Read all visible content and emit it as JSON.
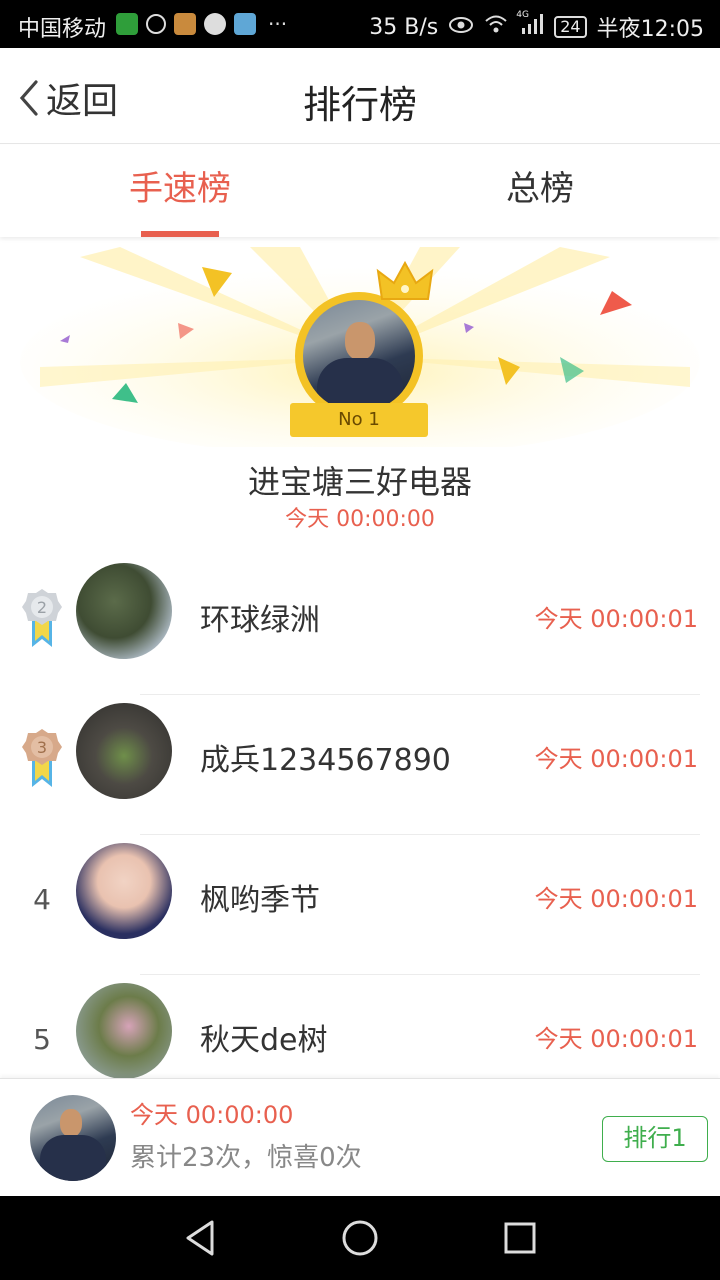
{
  "status_bar": {
    "carrier": "中国移动",
    "network_speed": "35 B/s",
    "network_type": "4G",
    "battery": "24",
    "time": "半夜12:05",
    "overflow": "···"
  },
  "header": {
    "back_label": "返回",
    "title": "排行榜"
  },
  "tabs": [
    {
      "label": "手速榜",
      "active": true
    },
    {
      "label": "总榜",
      "active": false
    }
  ],
  "winner": {
    "badge": "No 1",
    "name": "进宝塘三好电器",
    "time": "今天 00:00:00"
  },
  "rankings": [
    {
      "rank": "2",
      "name": "环球绿洲",
      "time": "今天 00:00:01",
      "medal": "silver"
    },
    {
      "rank": "3",
      "name": "成兵1234567890",
      "time": "今天 00:00:01",
      "medal": "bronze"
    },
    {
      "rank": "4",
      "name": "枫哟季节",
      "time": "今天 00:00:01"
    },
    {
      "rank": "5",
      "name": "秋天de树",
      "time": "今天 00:00:01"
    }
  ],
  "my_summary": {
    "time": "今天 00:00:00",
    "stats": "累计23次，惊喜0次",
    "rank_button": "排行1"
  },
  "colors": {
    "accent": "#e8604f",
    "green": "#3fae4d",
    "gold": "#f3c225"
  }
}
